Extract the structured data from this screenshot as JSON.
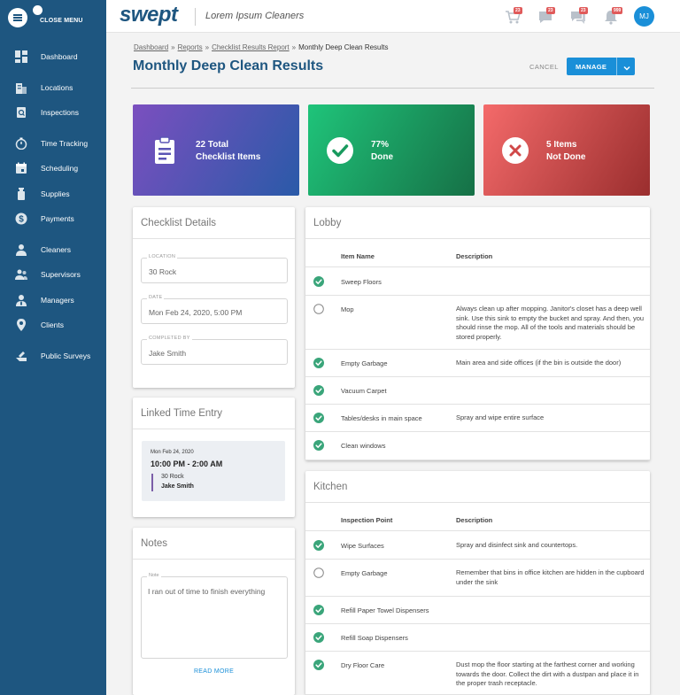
{
  "sidebar": {
    "close_label": "CLOSE MENU",
    "items": [
      {
        "label": "Dashboard",
        "icon": "dashboard-icon"
      },
      {
        "label": "Locations",
        "icon": "building-icon"
      },
      {
        "label": "Inspections",
        "icon": "inspection-icon"
      },
      {
        "label": "Time Tracking",
        "icon": "stopwatch-icon"
      },
      {
        "label": "Scheduling",
        "icon": "calendar-icon"
      },
      {
        "label": "Supplies",
        "icon": "supplies-icon"
      },
      {
        "label": "Payments",
        "icon": "dollar-icon"
      },
      {
        "label": "Cleaners",
        "icon": "user-icon"
      },
      {
        "label": "Supervisors",
        "icon": "users-icon"
      },
      {
        "label": "Managers",
        "icon": "user-tie-icon"
      },
      {
        "label": "Clients",
        "icon": "map-pin-icon"
      },
      {
        "label": "Public Surveys",
        "icon": "survey-icon"
      }
    ]
  },
  "topbar": {
    "logo": "swept",
    "company": "Lorem Ipsum Cleaners",
    "badges": {
      "cart": "23",
      "chat": "23",
      "messages": "23",
      "notifications": "999"
    },
    "avatar": "MJ"
  },
  "breadcrumb": {
    "dashboard": "Dashboard",
    "reports": "Reports",
    "checklist_results": "Checklist Results Report",
    "current": "Monthly Deep Clean Results",
    "sep": "»"
  },
  "page": {
    "title": "Monthly Deep Clean Results",
    "cancel": "CANCEL",
    "manage": "MANAGE"
  },
  "stats": {
    "total": {
      "line1": "22 Total",
      "line2": "Checklist Items",
      "color_from": "#7b4fbf",
      "color_to": "#2a5aa8"
    },
    "done": {
      "line1": "77%",
      "line2": "Done",
      "color_from": "#1fc47a",
      "color_to": "#167046"
    },
    "not_done": {
      "line1": "5 Items",
      "line2": "Not Done",
      "color_from": "#f46a6a",
      "color_to": "#9a2e2e"
    }
  },
  "details": {
    "title": "Checklist Details",
    "location_label": "LOCATION",
    "location": "30 Rock",
    "date_label": "DATE",
    "date": "Mon Feb 24, 2020, 5:00 PM",
    "completed_label": "COMPLETED BY",
    "completed_by": "Jake Smith"
  },
  "time_entry": {
    "title": "Linked Time Entry",
    "date": "Mon Feb 24, 2020",
    "range": "10:00 PM - 2:00 AM",
    "location": "30 Rock",
    "name": "Jake Smith"
  },
  "notes": {
    "title": "Notes",
    "label": "Note",
    "text": "I ran out of time to finish everything",
    "read_more": "READ MORE"
  },
  "lobby": {
    "title": "Lobby",
    "col1": "Item Name",
    "col2": "Description",
    "rows": [
      {
        "name": "Sweep Floors",
        "desc": "",
        "done": true
      },
      {
        "name": "Mop",
        "desc": "Always clean up after mopping. Janitor's closet has a deep well sink. Use this sink to empty the bucket and spray. And then, you should rinse the mop. All of the tools and materials should be stored properly.",
        "done": false
      },
      {
        "name": "Empty Garbage",
        "desc": "Main area and side offices (if the bin is outside the door)",
        "done": true
      },
      {
        "name": "Vacuum Carpet",
        "desc": "",
        "done": true
      },
      {
        "name": "Tables/desks in main space",
        "desc": "Spray and wipe entire surface",
        "done": true
      },
      {
        "name": "Clean windows",
        "desc": "",
        "done": true
      }
    ]
  },
  "kitchen": {
    "title": "Kitchen",
    "col1": "Inspection Point",
    "col2": "Description",
    "rows": [
      {
        "name": "Wipe Surfaces",
        "desc": "Spray and disinfect sink and countertops.",
        "done": true
      },
      {
        "name": "Empty Garbage",
        "desc": "Remember that bins in office kitchen are hidden in the cupboard under the sink",
        "done": false
      },
      {
        "name": "Refill Paper Towel Dispensers",
        "desc": "",
        "done": true
      },
      {
        "name": "Refill Soap Dispensers",
        "desc": "",
        "done": true
      },
      {
        "name": "Dry Floor Care",
        "desc": "Dust mop the floor starting at the farthest corner and working towards the door. Collect the dirt with a dustpan and place it in the proper trash receptacle.",
        "done": true
      }
    ]
  },
  "colors": {
    "primary": "#1e5680",
    "accent": "#1a8fd8",
    "check": "#3aa57a"
  }
}
